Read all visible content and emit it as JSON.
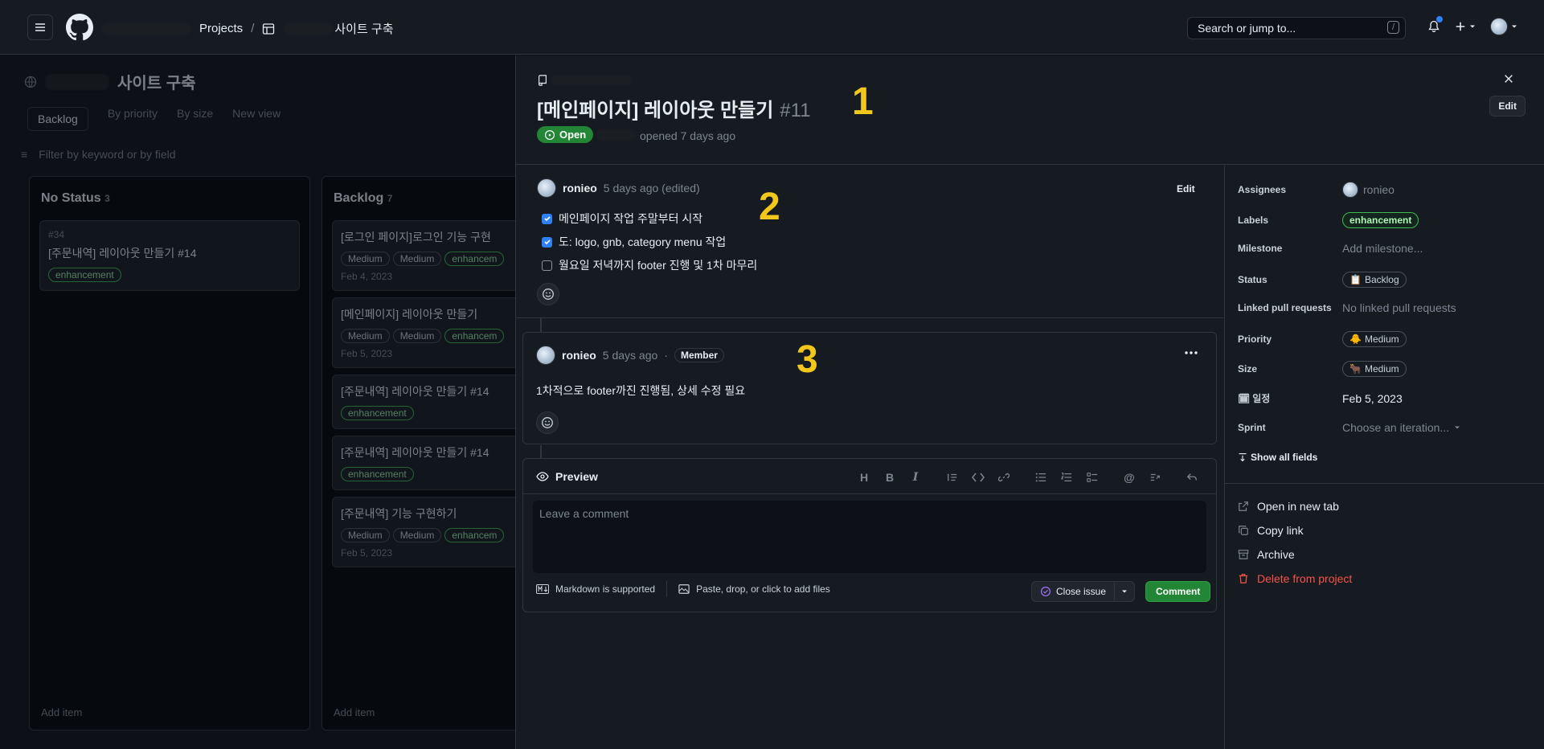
{
  "header": {
    "breadcrumb_projects": "Projects",
    "breadcrumb_sep": "/",
    "project_name_suffix": "사이트 구축",
    "search_placeholder": "Search or jump to...",
    "search_shortcut": "/"
  },
  "board": {
    "project_title": "사이트 구축",
    "views": [
      "Backlog",
      "By priority",
      "By size",
      "New view"
    ],
    "filter_placeholder": "Filter by keyword or by field",
    "columns": [
      {
        "name": "No Status",
        "count": "3"
      },
      {
        "name": "Backlog",
        "count": "7"
      }
    ],
    "cards_col1": [
      {
        "title": "[주문내역] 레이아웃 만들기 #14",
        "tag": "enhancement",
        "num": "#34"
      }
    ],
    "cards_col2": [
      {
        "title": "[로그인 페이지]로그인 기능 구현",
        "date": "Feb 4, 2023"
      },
      {
        "title": "[메인페이지] 레이아웃 만들기",
        "date": "Feb 5, 2023"
      },
      {
        "title": "[주문내역] 레이아웃 만들기 #14",
        "tag": "enhancement"
      },
      {
        "title": "[주문내역] 레이아웃 만들기 #14",
        "tag": "enhancement"
      },
      {
        "title": "[주문내역] 기능 구현하기",
        "date": "Feb 5, 2023"
      }
    ],
    "card_medium": "Medium",
    "card_enh": "enhancem",
    "add_item": "Add item"
  },
  "issue": {
    "title": "[메인페이지] 레이아웃 만들기",
    "number": "#11",
    "status": "Open",
    "opened_text": "opened 7 days ago",
    "edit_label": "Edit",
    "marker_1": "1",
    "marker_2": "2",
    "marker_3": "3"
  },
  "comment1": {
    "author": "ronieo",
    "meta": "5 days ago (edited)",
    "edit_label": "Edit",
    "tasks": [
      {
        "text": "메인페이지 작업 주말부터 시작",
        "checked": true
      },
      {
        "text": "도: logo, gnb, category menu 작업",
        "checked": true
      },
      {
        "text": "월요일 저녁까지 footer 진행 및 1차 마무리",
        "checked": false
      }
    ]
  },
  "comment2": {
    "author": "ronieo",
    "meta": "5 days ago",
    "dot": "·",
    "role": "Member",
    "body": "1차적으로 footer까진 진행됨, 상세 수정 필요"
  },
  "editor": {
    "preview_label": "Preview",
    "placeholder": "Leave a comment",
    "markdown_note": "Markdown is supported",
    "attach_note": "Paste, drop, or click to add files",
    "close_issue": "Close issue",
    "comment_btn": "Comment"
  },
  "sidebar": {
    "assignees_label": "Assignees",
    "assignee": "ronieo",
    "labels_label": "Labels",
    "label_value": "enhancement",
    "milestone_label": "Milestone",
    "milestone_value": "Add milestone...",
    "status_label": "Status",
    "status_value": "Backlog",
    "linked_label": "Linked pull requests",
    "linked_value": "No linked pull requests",
    "priority_label": "Priority",
    "priority_value": "Medium",
    "size_label": "Size",
    "size_value": "Medium",
    "date_label": "일정",
    "date_value": "Feb 5, 2023",
    "sprint_label": "Sprint",
    "sprint_value": "Choose an iteration...",
    "show_all": "Show all fields",
    "actions": {
      "open_tab": "Open in new tab",
      "copy_link": "Copy link",
      "archive": "Archive",
      "delete": "Delete from project"
    }
  },
  "colors": {
    "accent_green": "#238636",
    "marker_yellow": "#f2c71c",
    "danger": "#f85149"
  }
}
